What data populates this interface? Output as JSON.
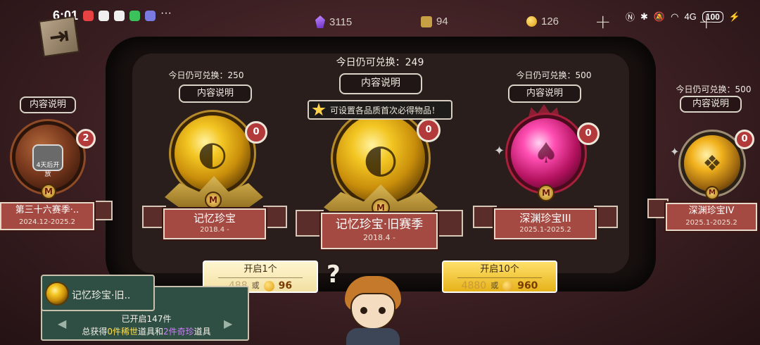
{
  "status_bar": {
    "time": "6:01",
    "more": "···",
    "network": "4G",
    "battery": "100"
  },
  "currencies": [
    {
      "icon": "purple-gem-icon",
      "value": "3115"
    },
    {
      "icon": "puzzle-piece-icon",
      "value": "94"
    },
    {
      "icon": "gold-coin-icon",
      "value": "126"
    }
  ],
  "tooltip": {
    "text": "可设置各品质首次必得物品！"
  },
  "cards": {
    "far_left": {
      "quota": "",
      "info": "内容说明",
      "count": "2",
      "lock_text": "4天后开放",
      "name": "第三十六赛季·..",
      "dates": "2024.12-2025.2"
    },
    "left": {
      "quota": "今日仍可兑换：250",
      "info": "内容说明",
      "count": "0",
      "name": "记忆珍宝",
      "dates": "2018.4 -"
    },
    "center": {
      "quota": "今日仍可兑换：249",
      "info": "内容说明",
      "count": "0",
      "name": "记忆珍宝·旧赛季",
      "dates": "2018.4 -"
    },
    "right": {
      "quota": "今日仍可兑换：500",
      "info": "内容说明",
      "count": "0",
      "name": "深渊珍宝III",
      "dates": "2025.1-2025.2"
    },
    "far_right": {
      "quota": "今日仍可兑换：500",
      "info": "内容说明",
      "count": "0",
      "name": "深渊珍宝IV",
      "dates": "2025.1-2025.2"
    }
  },
  "buttons": {
    "open_one": {
      "label": "开启1个",
      "cost_a": "488",
      "or": "或",
      "cost_b": "96"
    },
    "open_ten": {
      "label": "开启10个",
      "cost_a": "4880",
      "or": "或",
      "cost_b": "960"
    }
  },
  "log": {
    "title": "记忆珍宝·旧..",
    "opened": "已开启147件",
    "summary_prefix": "总获得",
    "rare_count": "0件",
    "rare_label": "稀世",
    "summary_mid": "道具和",
    "epic_count": "2件",
    "epic_label": "奇珍",
    "summary_suffix": "道具"
  },
  "character": {
    "thought": "?"
  },
  "colors": {
    "rare": "#ffe04a",
    "epic": "#d27cff",
    "banner": "#a54a42"
  }
}
